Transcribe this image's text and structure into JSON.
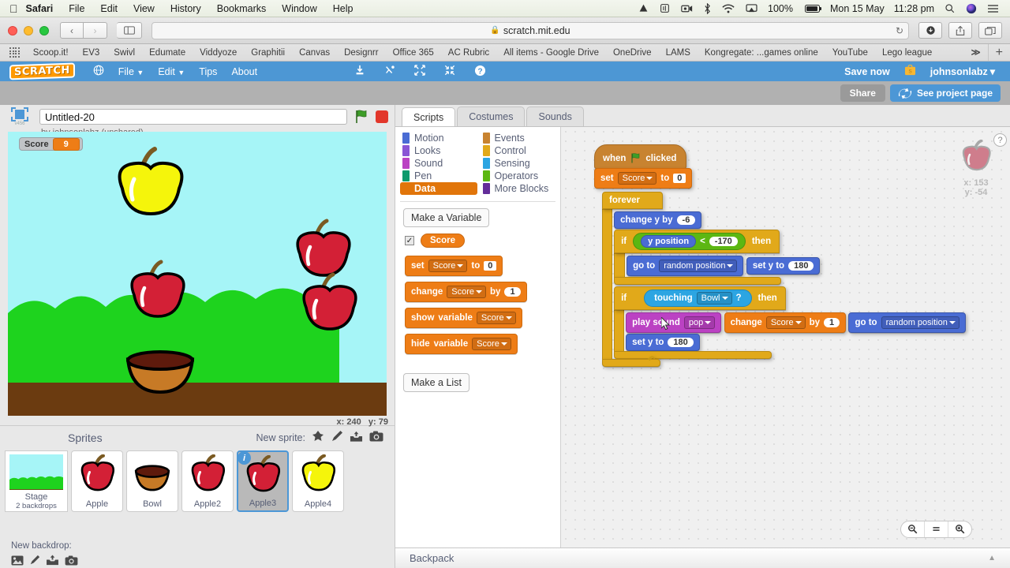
{
  "macmenu": {
    "apple": "",
    "items": [
      "Safari",
      "File",
      "Edit",
      "View",
      "History",
      "Bookmarks",
      "Window",
      "Help"
    ],
    "status": {
      "battery_pct": "100%",
      "date": "Mon 15 May",
      "time": "11:28 pm",
      "icons": [
        "drive-icon",
        "airplay-audio-icon",
        "screen-record-icon",
        "bluetooth-icon",
        "wifi-icon",
        "airplay-icon",
        "battery-icon",
        "spotlight-search-icon",
        "siri-icon",
        "notification-center-icon"
      ]
    }
  },
  "safari": {
    "url": "scratch.mit.edu",
    "lock": "lock-icon",
    "nav_back": "‹",
    "nav_forward": "›",
    "sidebar_icon": "sidebar-icon",
    "reload_icon": "reload-icon",
    "right_icons": [
      "downloads-icon",
      "share-icon",
      "tabs-icon"
    ],
    "bookmarks": [
      "Scoop.it!",
      "EV3",
      "Swivl",
      "Edumate",
      "Viddyoze",
      "Graphitii",
      "Canvas",
      "Designrr",
      "Office 365",
      "AC Rubric",
      "All items - Google Drive",
      "OneDrive",
      "LAMS",
      "Kongregate: ...games online",
      "YouTube",
      "Lego league"
    ],
    "bookmarks_overflow": "≫",
    "new_tab": "+"
  },
  "scratch": {
    "logo": "SCRATCH",
    "globe_icon": "globe-icon",
    "menu": [
      "File",
      "Edit",
      "Tips",
      "About"
    ],
    "toolbar_icons": [
      "duplicate-icon",
      "delete-icon",
      "grow-icon",
      "shrink-icon",
      "help-icon"
    ],
    "save_now": "Save now",
    "username": "johnsonlabz",
    "user_caret": "▾",
    "share": "Share",
    "see_project_page": "See project page",
    "project_title": "Untitled-20",
    "project_by": "by johnsonlabz (unshared)",
    "stage_version_label": "v456",
    "green_flag": "green-flag-icon",
    "stop_button": "stop-icon",
    "stage": {
      "watcher_label": "Score",
      "watcher_value": "9",
      "mouse_x_label": "x:",
      "mouse_x": "240",
      "mouse_y_label": "y:",
      "mouse_y": "79"
    },
    "sprites_panel": {
      "title": "Sprites",
      "new_sprite_label": "New sprite:",
      "new_sprite_icons": [
        "choose-sprite-icon",
        "paint-sprite-icon",
        "upload-sprite-icon",
        "camera-sprite-icon"
      ],
      "stage_label": "Stage",
      "stage_backdrops": "2 backdrops",
      "sprites": [
        {
          "name": "Apple",
          "type": "apple-red",
          "selected": false,
          "info": false
        },
        {
          "name": "Bowl",
          "type": "bowl",
          "selected": false,
          "info": false
        },
        {
          "name": "Apple2",
          "type": "apple-red",
          "selected": false,
          "info": false
        },
        {
          "name": "Apple3",
          "type": "apple-red",
          "selected": true,
          "info": true,
          "badge": "i"
        },
        {
          "name": "Apple4",
          "type": "apple-yellow",
          "selected": false,
          "info": false
        }
      ],
      "new_backdrop_label": "New backdrop:",
      "new_backdrop_icons": [
        "choose-backdrop-icon",
        "paint-backdrop-icon",
        "upload-backdrop-icon",
        "camera-backdrop-icon"
      ]
    },
    "tabs": [
      {
        "label": "Scripts",
        "active": true
      },
      {
        "label": "Costumes",
        "active": false
      },
      {
        "label": "Sounds",
        "active": false
      }
    ],
    "categories": [
      {
        "label": "Motion",
        "color": "#4a6cd4",
        "selected": false
      },
      {
        "label": "Events",
        "color": "#c88330",
        "selected": false
      },
      {
        "label": "Looks",
        "color": "#8a55d5",
        "selected": false
      },
      {
        "label": "Control",
        "color": "#e1a91a",
        "selected": false
      },
      {
        "label": "Sound",
        "color": "#bb42c3",
        "selected": false
      },
      {
        "label": "Sensing",
        "color": "#2ca5e2",
        "selected": false
      },
      {
        "label": "Pen",
        "color": "#0e9a6c",
        "selected": false
      },
      {
        "label": "Operators",
        "color": "#5cb712",
        "selected": false
      },
      {
        "label": "Data",
        "color": "#ee7d16",
        "selected": true
      },
      {
        "label": "More Blocks",
        "color": "#632d99",
        "selected": false
      }
    ],
    "palette": {
      "make_variable": "Make a Variable",
      "variable_name": "Score",
      "variable_checked": "✓",
      "make_list": "Make a List",
      "blocks": [
        {
          "id": "set-var",
          "words": [
            "set"
          ],
          "dropdown": "Score",
          "mid": "to",
          "value": "0"
        },
        {
          "id": "change-var",
          "words": [
            "change"
          ],
          "dropdown": "Score",
          "mid": "by",
          "value": "1"
        },
        {
          "id": "show-var",
          "words": [
            "show",
            "variable"
          ],
          "dropdown": "Score"
        },
        {
          "id": "hide-var",
          "words": [
            "hide",
            "variable"
          ],
          "dropdown": "Score"
        }
      ]
    },
    "script": {
      "when_flag_clicked": {
        "pre": "when",
        "post": "clicked",
        "icon": "green-flag-icon"
      },
      "set_score": {
        "label": "set",
        "var": "Score",
        "to": "to",
        "value": "0"
      },
      "forever": "forever",
      "change_y": {
        "label": "change y by",
        "value": "-6"
      },
      "if1": {
        "if": "if",
        "then": "then",
        "operand": "y position",
        "op": "<",
        "value": "-170"
      },
      "go_to_random_1": {
        "label": "go to",
        "value": "random position"
      },
      "set_y_180_1": {
        "label": "set y to",
        "value": "180"
      },
      "if2": {
        "if": "if",
        "then": "then",
        "sensing": "touching",
        "target": "Bowl",
        "q": "?"
      },
      "play_sound": {
        "label": "play sound",
        "value": "pop"
      },
      "change_score": {
        "label": "change",
        "var": "Score",
        "by": "by",
        "value": "1"
      },
      "go_to_random_2": {
        "label": "go to",
        "value": "random position"
      },
      "set_y_180_2": {
        "label": "set y to",
        "value": "180"
      }
    },
    "sprite_info_watermark": {
      "x_label": "x:",
      "x": "153",
      "y_label": "y:",
      "y": "-54"
    },
    "help_icon": "?",
    "zoom_controls": [
      "zoom-out-icon",
      "zoom-reset-icon",
      "zoom-in-icon"
    ],
    "backpack": "Backpack",
    "backpack_arrow": "▲"
  }
}
